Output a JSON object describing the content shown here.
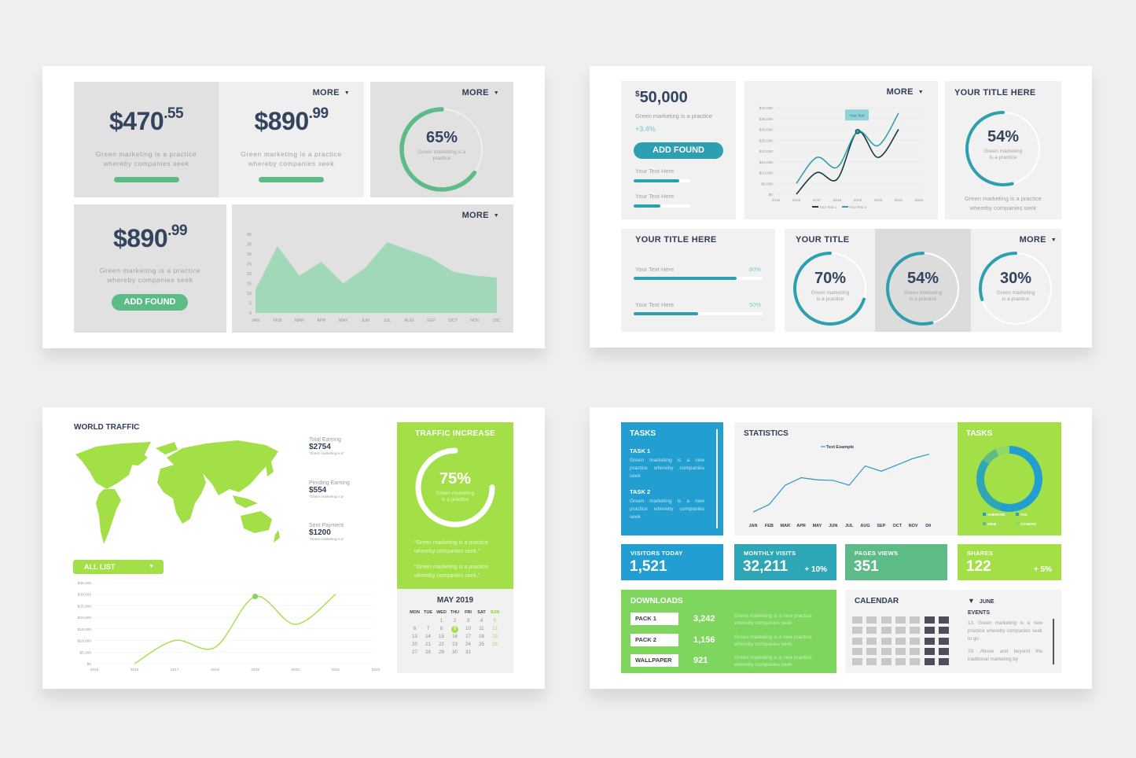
{
  "slide1": {
    "card1": {
      "price_main": "$470",
      "price_cents": ".55",
      "desc1": "Green marketing is a practice",
      "desc2": "whereby companies seek",
      "progress": 1.0
    },
    "card2": {
      "more": "MORE",
      "price_main": "$890",
      "price_cents": ".99",
      "desc1": "Green marketing is a practice",
      "desc2": "whereby companies seek",
      "progress": 1.0
    },
    "card3": {
      "more": "MORE",
      "percent_label": "65%",
      "percent": 65,
      "sub1": "Green marketing is a",
      "sub2": "practice"
    },
    "card4": {
      "price_main": "$890",
      "price_cents": ".99",
      "desc1": "Green marketing is a practice",
      "desc2": "whereby companies seek",
      "button": "ADD FOUND"
    },
    "card5": {
      "more": "MORE"
    }
  },
  "slide2": {
    "card1": {
      "amount_symbol": "$",
      "amount": "50,000",
      "desc": "Green marketing is a practice",
      "change": "+3.4%",
      "button": "ADD FOUND",
      "bars": [
        {
          "label": "Your Text Here",
          "value": 0.8
        },
        {
          "label": "Your Text Here",
          "value": 0.47
        }
      ]
    },
    "card2": {
      "more": "MORE",
      "tooltip": "Your Text"
    },
    "card3": {
      "title": "YOUR TITLE HERE",
      "percent_label": "54%",
      "percent": 54,
      "sub1": "Green marketing",
      "sub2": "is a practice",
      "desc1": "Green marketing is a practice",
      "desc2": "whereby companies seek"
    },
    "card4": {
      "title": "YOUR TITLE HERE",
      "bars": [
        {
          "label": "Your Text Here",
          "pct_label": "80%",
          "value": 0.8
        },
        {
          "label": "Your Text Here",
          "pct_label": "50%",
          "value": 0.5
        }
      ]
    },
    "card5": {
      "title": "YOUR TITLE",
      "more": "MORE",
      "rings": [
        {
          "label": "70%",
          "value": 70,
          "sub1": "Green marketing",
          "sub2": "is a practice"
        },
        {
          "label": "54%",
          "value": 54,
          "sub1": "Green marketing",
          "sub2": "is a practice"
        },
        {
          "label": "30%",
          "value": 30,
          "sub1": "Green marketing",
          "sub2": "is a practice"
        }
      ]
    }
  },
  "slide3": {
    "title": "WORLD TRAFFIC",
    "earnings": [
      {
        "label": "Total Earning",
        "value": "$2754",
        "note": "\"Green marketing is a\""
      },
      {
        "label": "Pending Earning",
        "value": "$554",
        "note": "\"Green marketing is a\""
      },
      {
        "label": "Sent Payment",
        "value": "$1200",
        "note": "\"Green marketing is a\""
      }
    ],
    "dropdown": {
      "label": "ALL LIST"
    },
    "traffic": {
      "title": "TRAFFIC INCREASE",
      "percent_label": "75%",
      "percent": 75,
      "sub1": "Green marketing",
      "sub2": "is a practice",
      "quote1a": "\"Green marketing is a practice",
      "quote1b": "whereby companies seek.\"",
      "quote2a": "\"Green marketing is a practice",
      "quote2b": "whereby companies seek.\""
    },
    "calendar": {
      "title": "MAY 2019",
      "days": [
        "MON",
        "TUE",
        "WED",
        "THU",
        "FRI",
        "SAT",
        "SUN"
      ],
      "weeks": [
        [
          "",
          "",
          "1",
          "2",
          "3",
          "4",
          "5"
        ],
        [
          "6",
          "7",
          "8",
          "9",
          "10",
          "11",
          "12"
        ],
        [
          "13",
          "14",
          "15",
          "16",
          "17",
          "18",
          "19"
        ],
        [
          "20",
          "21",
          "22",
          "23",
          "24",
          "25",
          "26"
        ],
        [
          "27",
          "28",
          "29",
          "30",
          "31",
          "",
          ""
        ]
      ],
      "selected": "9"
    }
  },
  "slide4": {
    "tasks": {
      "title": "TASKS",
      "items": [
        {
          "title": "TASK 1",
          "desc": "Green marketing is a new practice whereby companies seek"
        },
        {
          "title": "TASK 2",
          "desc": "Green marketing is a new practice whereby companies seek"
        }
      ]
    },
    "statistics": {
      "title": "STATISTICS"
    },
    "tasks_donut": {
      "title": "TASKS",
      "legend": [
        "ANDROID",
        "IOS",
        "WEB",
        "OTHERS"
      ]
    },
    "stats": [
      {
        "label": "VISITORS TODAY",
        "value": "1,521",
        "change": ""
      },
      {
        "label": "MONTHLY VISITS",
        "value": "32,211",
        "change": "+ 10%"
      },
      {
        "label": "PAGES VIEWS",
        "value": "351",
        "change": ""
      },
      {
        "label": "SHARES",
        "value": "122",
        "change": "+ 5%"
      }
    ],
    "downloads": {
      "title": "DOWNLOADS",
      "items": [
        {
          "label": "PACK 1",
          "value": "3,242",
          "desc1": "Green marketing is a new practice",
          "desc2": "whereby companies seek"
        },
        {
          "label": "PACK 2",
          "value": "1,156",
          "desc1": "Green marketing is a new practice",
          "desc2": "whereby companies seek"
        },
        {
          "label": "WALLPAPER",
          "value": "921",
          "desc1": "Green marketing is a new practice",
          "desc2": "whereby companies seek"
        }
      ]
    },
    "calendar": {
      "title": "CALENDAR",
      "month": "JUNE",
      "events_title": "EVENTS",
      "events": [
        "13. Green marketing is a new practice whereby companies seek to go",
        "29. Above and beyond the traditional marketing by"
      ]
    }
  },
  "colors": {
    "green": "#5cbb87",
    "teal": "#2d9fb0",
    "lime": "#a3e048",
    "blue": "#229fd0",
    "navy": "#2f3d55"
  },
  "chart_data": [
    {
      "type": "area",
      "title": "",
      "categories": [
        "JAN",
        "FEB",
        "MAR",
        "APR",
        "MAY",
        "JUN",
        "JUL",
        "AUG",
        "SEP",
        "OCT",
        "NOV",
        "DIC"
      ],
      "values": [
        12,
        34,
        19,
        26,
        15,
        23,
        36,
        32,
        28,
        21,
        19,
        18
      ],
      "ylim": [
        0,
        40
      ],
      "yticks": [
        0,
        5,
        10,
        15,
        20,
        25,
        30,
        35,
        40
      ],
      "xlabel": "",
      "ylabel": ""
    },
    {
      "type": "line",
      "title": "",
      "x": [
        2016,
        2017,
        2018,
        2019,
        2020,
        2021
      ],
      "xticks": [
        "2015",
        "2016",
        "2017",
        "2018",
        "2019",
        "2020",
        "2021",
        "2022"
      ],
      "xlim": [
        2015,
        2022
      ],
      "series": [
        {
          "name": "Your Text 1",
          "values": [
            0,
            10000,
            7000,
            29000,
            17000,
            30000
          ]
        },
        {
          "name": "Your Text 2",
          "values": [
            5000,
            17000,
            12500,
            29000,
            22500,
            37500
          ]
        }
      ],
      "ylim": [
        0,
        40000
      ],
      "yticks": [
        "$0",
        "$5,000",
        "$10,000",
        "$15,000",
        "$20,000",
        "$25,000",
        "$30,000",
        "$35,000",
        "$40,000"
      ],
      "annotation": {
        "x": 2019,
        "text": "Your Text"
      },
      "legend": "bottom"
    },
    {
      "type": "line",
      "title": "",
      "x": [
        2016,
        2017,
        2018,
        2019,
        2020,
        2021
      ],
      "xticks": [
        "2015",
        "2016",
        "2017",
        "2018",
        "2019",
        "2020",
        "2021",
        "2022"
      ],
      "xlim": [
        2015,
        2022
      ],
      "series": [
        {
          "name": "All List",
          "values": [
            0,
            10000,
            7000,
            29000,
            17000,
            30000
          ]
        }
      ],
      "ylim": [
        0,
        35000
      ],
      "yticks": [
        "$0",
        "$5,000",
        "$10,000",
        "$15,000",
        "$20,000",
        "$25,000",
        "$30,000",
        "$35,000"
      ],
      "highlight_x": 2019
    },
    {
      "type": "line",
      "title": "STATISTICS",
      "categories": [
        "JAN",
        "FEB",
        "MAR",
        "APR",
        "MAY",
        "JUN",
        "JUL",
        "AUG",
        "SEP",
        "OCT",
        "NOV",
        "DIC"
      ],
      "series": [
        {
          "name": "Text Example",
          "values": [
            5,
            12,
            30,
            37,
            35,
            34.5,
            30,
            48,
            43,
            49,
            55,
            59
          ]
        }
      ],
      "ylim": [
        0,
        70
      ],
      "legend": "top"
    },
    {
      "type": "pie",
      "title": "TASKS",
      "labels": [
        "ANDROID",
        "IOS",
        "WEB",
        "OTHERS"
      ],
      "values": [
        55,
        30,
        8,
        7
      ],
      "legend": "bottom"
    }
  ]
}
